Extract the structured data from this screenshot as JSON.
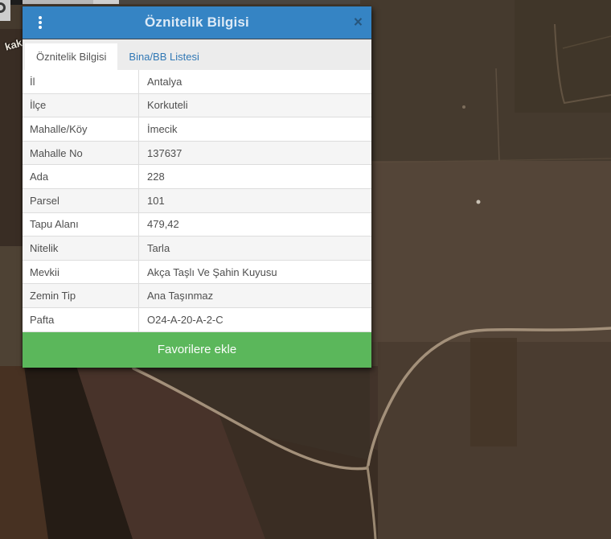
{
  "dialog": {
    "title": "Öznitelik Bilgisi",
    "tabs": [
      {
        "label": "Öznitelik Bilgisi",
        "active": true
      },
      {
        "label": "Bina/BB Listesi",
        "active": false
      }
    ],
    "table": {
      "rows": [
        {
          "label": "İl",
          "value": "Antalya"
        },
        {
          "label": "İlçe",
          "value": "Korkuteli"
        },
        {
          "label": "Mahalle/Köy",
          "value": "İmecik"
        },
        {
          "label": "Mahalle No",
          "value": "137637"
        },
        {
          "label": "Ada",
          "value": "228"
        },
        {
          "label": "Parsel",
          "value": "101"
        },
        {
          "label": "Tapu Alanı",
          "value": "479,42"
        },
        {
          "label": "Nitelik",
          "value": "Tarla"
        },
        {
          "label": "Mevkii",
          "value": "Akça Taşlı Ve Şahin Kuyusu"
        },
        {
          "label": "Zemin Tip",
          "value": "Ana Taşınmaz"
        },
        {
          "label": "Pafta",
          "value": "O24-A-20-A-2-C"
        }
      ]
    },
    "favorite_button": "Favorilere ekle"
  },
  "icons": {
    "kebab_menu": "⋮",
    "close": "×"
  },
  "map": {
    "street_label": "kak"
  },
  "colors": {
    "header_blue": "#3584c4",
    "close_glyph_blue": "#27567d",
    "tab_link_blue": "#3178b5",
    "button_green": "#5bb75b",
    "map_base_brown": "#4e4234",
    "road_tan": "#a3907a",
    "row_alt_gray": "#f5f5f5"
  }
}
